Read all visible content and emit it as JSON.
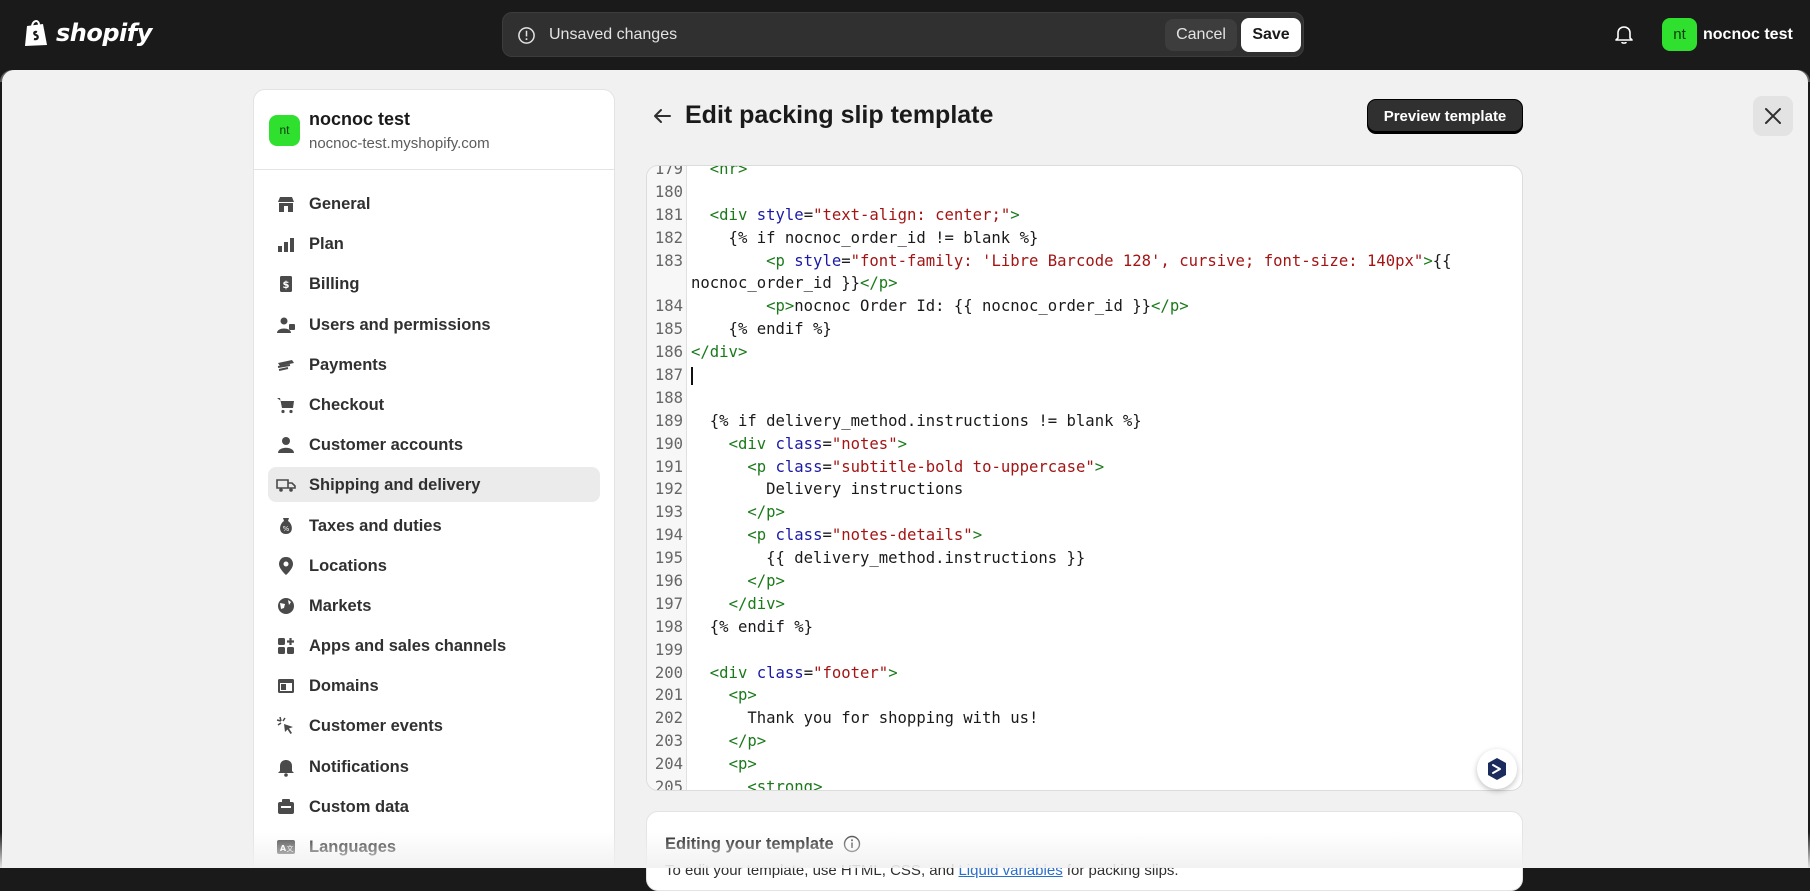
{
  "topbar": {
    "logo_text": "shopify",
    "unsaved_text": "Unsaved changes",
    "cancel_label": "Cancel",
    "save_label": "Save",
    "user_initials": "nt",
    "user_name": "nocnoc test"
  },
  "sidebar": {
    "store_initials": "nt",
    "store_name": "nocnoc test",
    "store_domain": "nocnoc-test.myshopify.com",
    "items": [
      {
        "label": "General",
        "icon": "store-icon"
      },
      {
        "label": "Plan",
        "icon": "plan-chart-icon"
      },
      {
        "label": "Billing",
        "icon": "billing-icon"
      },
      {
        "label": "Users and permissions",
        "icon": "users-icon"
      },
      {
        "label": "Payments",
        "icon": "payments-icon"
      },
      {
        "label": "Checkout",
        "icon": "cart-icon"
      },
      {
        "label": "Customer accounts",
        "icon": "person-icon"
      },
      {
        "label": "Shipping and delivery",
        "icon": "truck-icon",
        "active": true
      },
      {
        "label": "Taxes and duties",
        "icon": "tax-icon"
      },
      {
        "label": "Locations",
        "icon": "location-pin-icon"
      },
      {
        "label": "Markets",
        "icon": "globe-icon"
      },
      {
        "label": "Apps and sales channels",
        "icon": "apps-icon"
      },
      {
        "label": "Domains",
        "icon": "domains-icon"
      },
      {
        "label": "Customer events",
        "icon": "cursor-click-icon"
      },
      {
        "label": "Notifications",
        "icon": "bell-icon"
      },
      {
        "label": "Custom data",
        "icon": "custom-data-icon"
      },
      {
        "label": "Languages",
        "icon": "languages-icon"
      }
    ]
  },
  "main": {
    "title": "Edit packing slip template",
    "preview_label": "Preview template"
  },
  "editor": {
    "lines": [
      {
        "n": "179",
        "t": "  <hr>"
      },
      {
        "n": "180",
        "t": ""
      },
      {
        "n": "181",
        "t": "  <div style=\"text-align: center;\">"
      },
      {
        "n": "182",
        "t": "    {% if nocnoc_order_id != blank %}"
      },
      {
        "n": "183",
        "t": "        <p style=\"font-family: 'Libre Barcode 128', cursive; font-size: 140px\">{{"
      },
      {
        "n": "",
        "t": "nocnoc_order_id }}</p>"
      },
      {
        "n": "184",
        "t": "        <p>nocnoc Order Id: {{ nocnoc_order_id }}</p>"
      },
      {
        "n": "185",
        "t": "    {% endif %}"
      },
      {
        "n": "186",
        "t": "</div>"
      },
      {
        "n": "187",
        "t": ""
      },
      {
        "n": "188",
        "t": ""
      },
      {
        "n": "189",
        "t": "  {% if delivery_method.instructions != blank %}"
      },
      {
        "n": "190",
        "t": "    <div class=\"notes\">"
      },
      {
        "n": "191",
        "t": "      <p class=\"subtitle-bold to-uppercase\">"
      },
      {
        "n": "192",
        "t": "        Delivery instructions"
      },
      {
        "n": "193",
        "t": "      </p>"
      },
      {
        "n": "194",
        "t": "      <p class=\"notes-details\">"
      },
      {
        "n": "195",
        "t": "        {{ delivery_method.instructions }}"
      },
      {
        "n": "196",
        "t": "      </p>"
      },
      {
        "n": "197",
        "t": "    </div>"
      },
      {
        "n": "198",
        "t": "  {% endif %}"
      },
      {
        "n": "199",
        "t": ""
      },
      {
        "n": "200",
        "t": "  <div class=\"footer\">"
      },
      {
        "n": "201",
        "t": "    <p>"
      },
      {
        "n": "202",
        "t": "      Thank you for shopping with us!"
      },
      {
        "n": "203",
        "t": "    </p>"
      },
      {
        "n": "204",
        "t": "    <p>"
      },
      {
        "n": "205",
        "t": "      <strong>"
      }
    ]
  },
  "info": {
    "title": "Editing your template",
    "sub_prefix": "To edit your template, use HTML, CSS, and ",
    "sub_link": "Liquid variables",
    "sub_suffix": " for packing slips."
  },
  "colors": {
    "tag": "#1a7a1a",
    "attr": "#1a1aa6",
    "string": "#a31515",
    "accent_green": "#2fe02f",
    "link": "#2c6ecb"
  }
}
